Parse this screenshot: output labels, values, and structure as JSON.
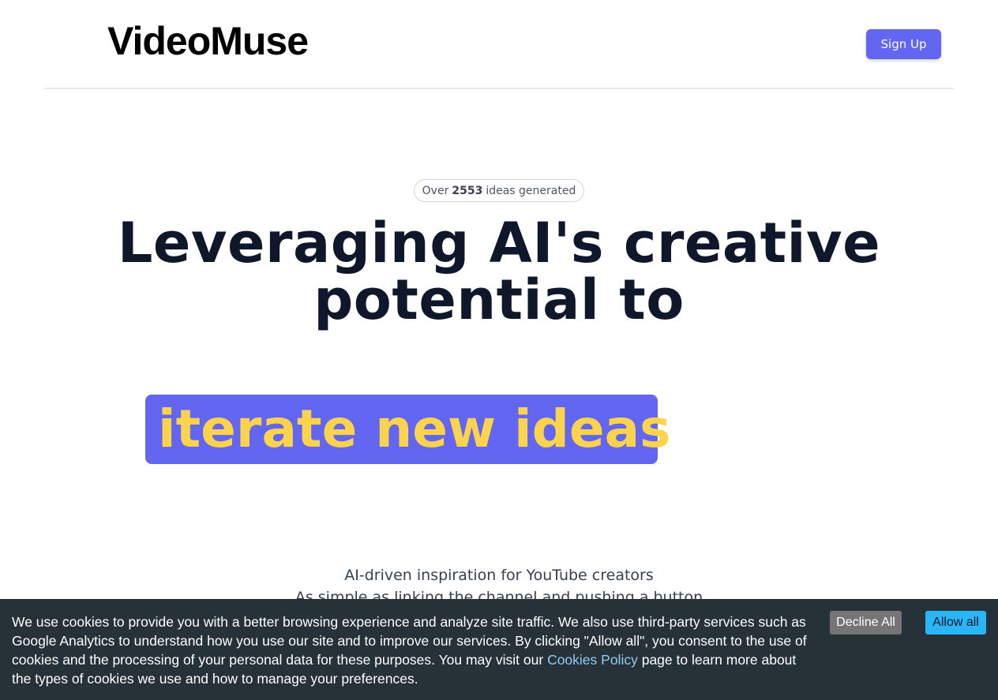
{
  "header": {
    "brand": "VideoMuse",
    "signup_label": "Sign Up"
  },
  "hero": {
    "badge_prefix": "Over",
    "badge_count": "2553",
    "badge_suffix": "ideas generated",
    "headline_line1": "Leveraging AI's creative",
    "headline_line2": "potential to",
    "highlight": "iterate new ideas",
    "sub_line1": "AI-driven inspiration for YouTube creators",
    "sub_line2": "As simple as linking the channel and pushing a button"
  },
  "cookie_banner": {
    "text_before_link": "We use cookies to provide you with a better browsing experience and analyze site traffic. We also use third-party services such as Google Analytics to understand how you use our site and to improve our services. By clicking \"Allow all\", you consent to the use of cookies and the processing of your personal data for these purposes. You may visit our",
    "link_label": "Cookies Policy",
    "text_after_link": "page to learn more about the types of cookies we use and how to manage your preferences.",
    "decline_label": "Decline All",
    "allow_label": "Allow all"
  },
  "colors": {
    "accent": "#6366f1",
    "highlight_text": "#fcd34d",
    "cookie_bg": "#263238",
    "allow_button": "#29b6f6",
    "decline_button": "#757575"
  }
}
